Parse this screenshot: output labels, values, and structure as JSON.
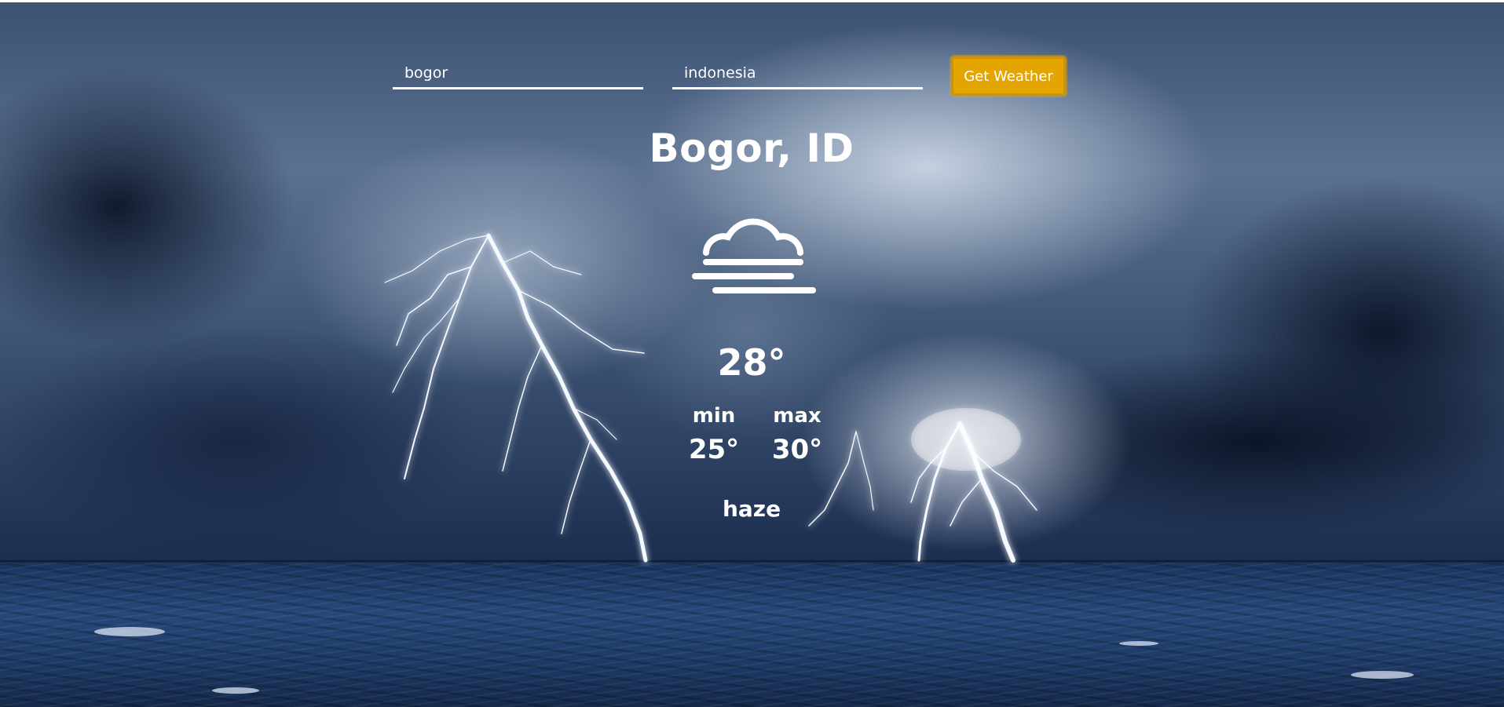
{
  "form": {
    "city_value": "bogor",
    "country_value": "indonesia",
    "button_label": "Get Weather"
  },
  "weather": {
    "location": "Bogor, ID",
    "icon": "haze-icon",
    "temperature": "28°",
    "min_label": "min",
    "min_value": "25°",
    "max_label": "max",
    "max_value": "30°",
    "description": "haze"
  },
  "colors": {
    "button": "#e5a500",
    "text": "#ffffff",
    "sky": "#3d5273",
    "sea": "#1d3a66"
  }
}
